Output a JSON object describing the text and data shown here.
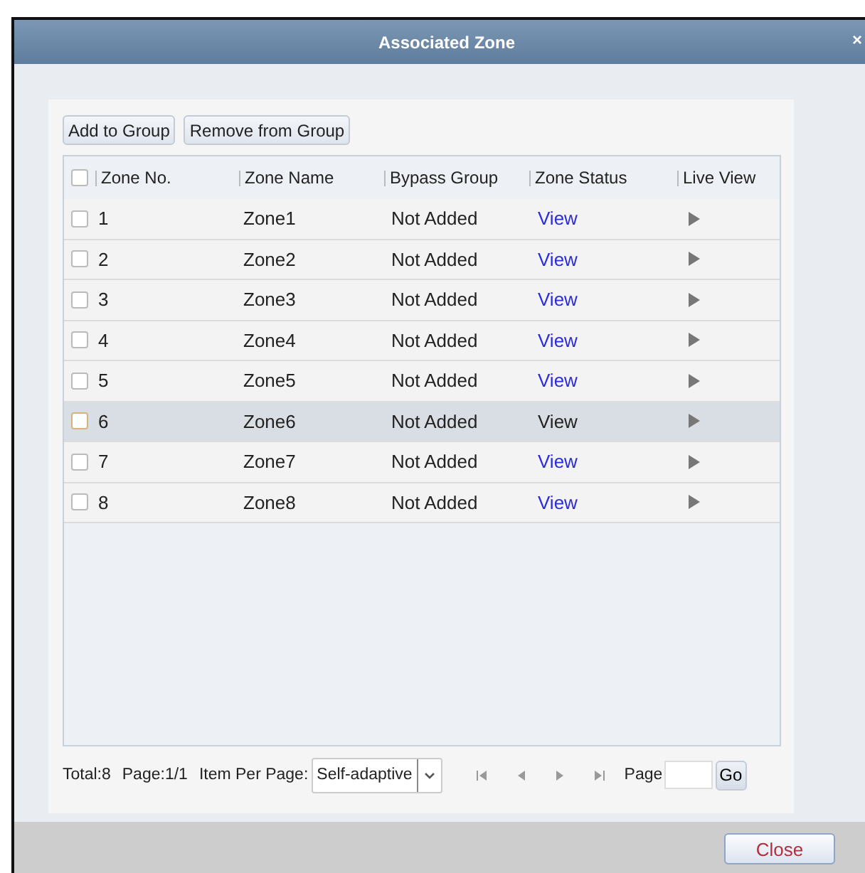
{
  "window": {
    "title": "Associated Zone",
    "close_glyph": "×"
  },
  "toolbar": [
    "Add to Group",
    "Remove from Group"
  ],
  "table": {
    "columns": [
      "Zone No.",
      "Zone Name",
      "Bypass Group",
      "Zone Status",
      "Live View"
    ],
    "select_all_checked": false,
    "rows": [
      {
        "no": "1",
        "name": "Zone1",
        "bypass": "Not Added",
        "status": "View",
        "selected": false,
        "checked": false
      },
      {
        "no": "2",
        "name": "Zone2",
        "bypass": "Not Added",
        "status": "View",
        "selected": false,
        "checked": false
      },
      {
        "no": "3",
        "name": "Zone3",
        "bypass": "Not Added",
        "status": "View",
        "selected": false,
        "checked": false
      },
      {
        "no": "4",
        "name": "Zone4",
        "bypass": "Not Added",
        "status": "View",
        "selected": false,
        "checked": false
      },
      {
        "no": "5",
        "name": "Zone5",
        "bypass": "Not Added",
        "status": "View",
        "selected": false,
        "checked": false
      },
      {
        "no": "6",
        "name": "Zone6",
        "bypass": "Not Added",
        "status": "View",
        "selected": true,
        "checked": false
      },
      {
        "no": "7",
        "name": "Zone7",
        "bypass": "Not Added",
        "status": "View",
        "selected": false,
        "checked": false
      },
      {
        "no": "8",
        "name": "Zone8",
        "bypass": "Not Added",
        "status": "View",
        "selected": false,
        "checked": false
      }
    ]
  },
  "pagination": {
    "total": "Total:8",
    "page": "Page:1/1",
    "per_page_label": "Item Per Page:",
    "per_page_value": "Self-adaptive",
    "page_label": "Page",
    "go": "Go"
  },
  "buttons": [
    "Close"
  ]
}
